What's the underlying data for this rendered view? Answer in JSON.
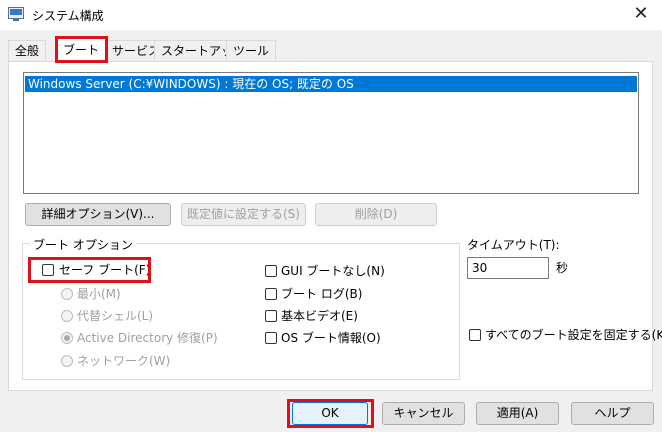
{
  "window": {
    "title": "システム構成",
    "close_glyph": "✕"
  },
  "tabs": [
    {
      "label": "全般"
    },
    {
      "label": "ブート"
    },
    {
      "label": "サービス"
    },
    {
      "label": "スタートアップ"
    },
    {
      "label": "ツール"
    }
  ],
  "os_list": {
    "items": [
      "Windows Server (C:¥WINDOWS) : 現在の OS; 既定の OS"
    ]
  },
  "boot_buttons": {
    "advanced": "詳細オプション(V)...",
    "set_default": "既定値に設定する(S)",
    "delete": "削除(D)"
  },
  "boot_options": {
    "group_label": "ブート オプション",
    "safe_boot": "セーフ ブート(F)",
    "minimal": "最小(M)",
    "alternate_shell": "代替シェル(L)",
    "active_directory": "Active Directory 修復(P)",
    "network": "ネットワーク(W)",
    "no_gui": "GUI ブートなし(N)",
    "boot_log": "ブート ログ(B)",
    "base_video": "基本ビデオ(E)",
    "os_boot_info": "OS ブート情報(O)"
  },
  "timeout": {
    "label": "タイムアウト(T):",
    "value": "30",
    "unit": "秒"
  },
  "make_permanent": "すべてのブート設定を固定する(K)",
  "footer": {
    "ok": "OK",
    "cancel": "キャンセル",
    "apply": "適用(A)",
    "help": "ヘルプ"
  },
  "colors": {
    "highlight": "#e0101a",
    "selection": "#0078d7"
  }
}
